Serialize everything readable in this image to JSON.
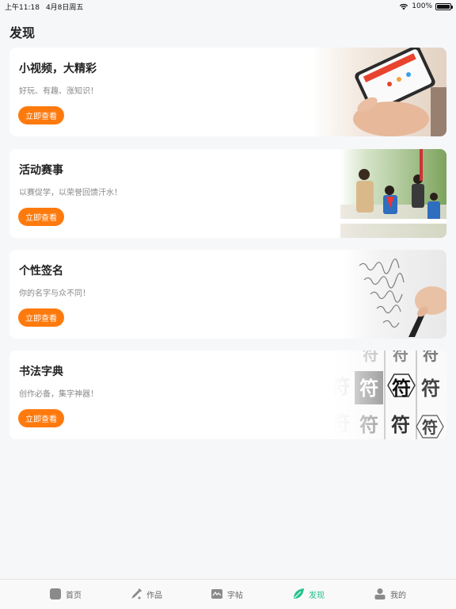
{
  "status_bar": {
    "time": "上午11:18",
    "date": "4月8日周五",
    "battery": "100%"
  },
  "page_title": "发现",
  "cards": [
    {
      "title": "小视频，大精彩",
      "subtitle": "好玩、有趣、涨知识！",
      "button": "立即查看",
      "image_icon": "phone-in-hand-photo"
    },
    {
      "title": "活动赛事",
      "subtitle": "以赛促学，以荣誉回馈汗水！",
      "button": "立即查看",
      "image_icon": "outdoor-calligraphy-event-photo"
    },
    {
      "title": "个性签名",
      "subtitle": "你的名字与众不同！",
      "button": "立即查看",
      "image_icon": "handwriting-pen-photo"
    },
    {
      "title": "书法字典",
      "subtitle": "创作必备，集字神器！",
      "button": "立即查看",
      "image_icon": "calligraphy-character-grid"
    }
  ],
  "tabs": [
    {
      "label": "首页",
      "icon": "home-icon",
      "active": false
    },
    {
      "label": "作品",
      "icon": "brush-icon",
      "active": false
    },
    {
      "label": "字帖",
      "icon": "copybook-icon",
      "active": false
    },
    {
      "label": "发现",
      "icon": "leaf-icon",
      "active": true
    },
    {
      "label": "我的",
      "icon": "profile-icon",
      "active": false
    }
  ],
  "colors": {
    "accent_orange": "#ff7a0d",
    "active_tab_green": "#1fc28a",
    "background": "#f6f7f9"
  },
  "calligraphy_sample_char": "符"
}
